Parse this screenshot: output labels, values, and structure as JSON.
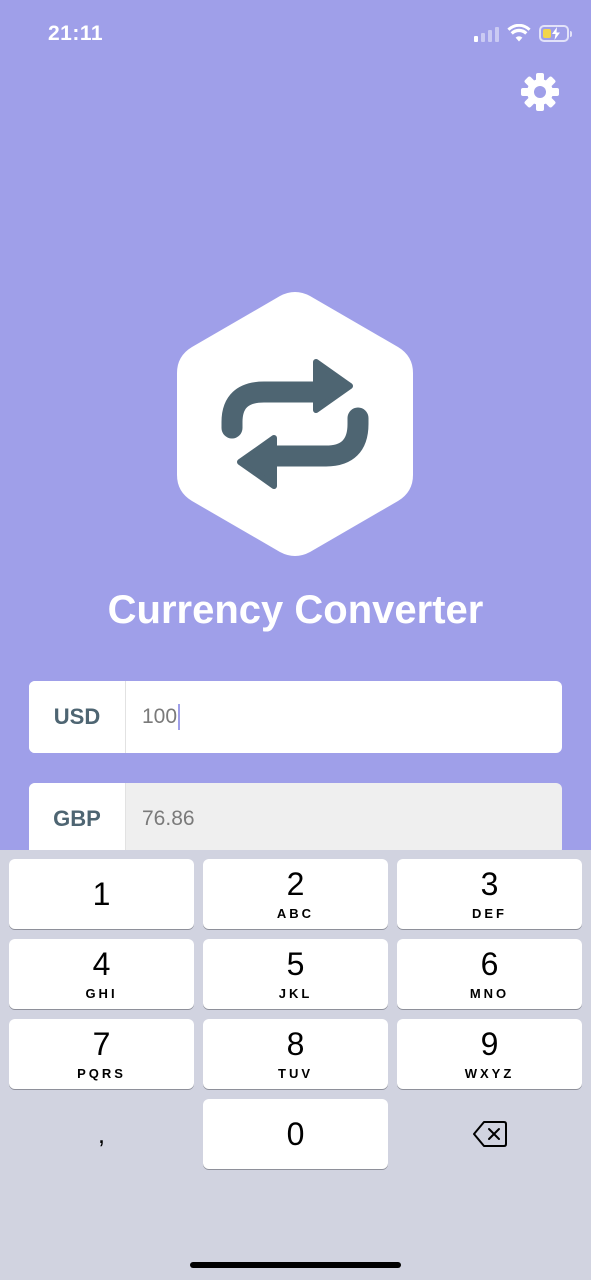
{
  "status_bar": {
    "time": "21:11",
    "icons": [
      "cellular-signal-icon",
      "wifi-icon",
      "battery-charging-icon"
    ]
  },
  "settings": {
    "icon": "gear-icon"
  },
  "app": {
    "logo_icon": "swap-arrows-icon",
    "title": "Currency Converter"
  },
  "converter": {
    "from": {
      "code": "USD",
      "value": "100"
    },
    "to": {
      "code": "GBP",
      "value": "76.86"
    }
  },
  "keyboard": {
    "keys": [
      {
        "digit": "1",
        "letters": ""
      },
      {
        "digit": "2",
        "letters": "ABC"
      },
      {
        "digit": "3",
        "letters": "DEF"
      },
      {
        "digit": "4",
        "letters": "GHI"
      },
      {
        "digit": "5",
        "letters": "JKL"
      },
      {
        "digit": "6",
        "letters": "MNO"
      },
      {
        "digit": "7",
        "letters": "PQRS"
      },
      {
        "digit": "8",
        "letters": "TUV"
      },
      {
        "digit": "9",
        "letters": "WXYZ"
      },
      {
        "digit": ",",
        "letters": ""
      },
      {
        "digit": "0",
        "letters": ""
      }
    ],
    "delete_icon": "backspace-icon"
  },
  "colors": {
    "background": "#9F9FE9",
    "accent_dark": "#4E6572",
    "keyboard_bg": "#D1D3E0"
  }
}
